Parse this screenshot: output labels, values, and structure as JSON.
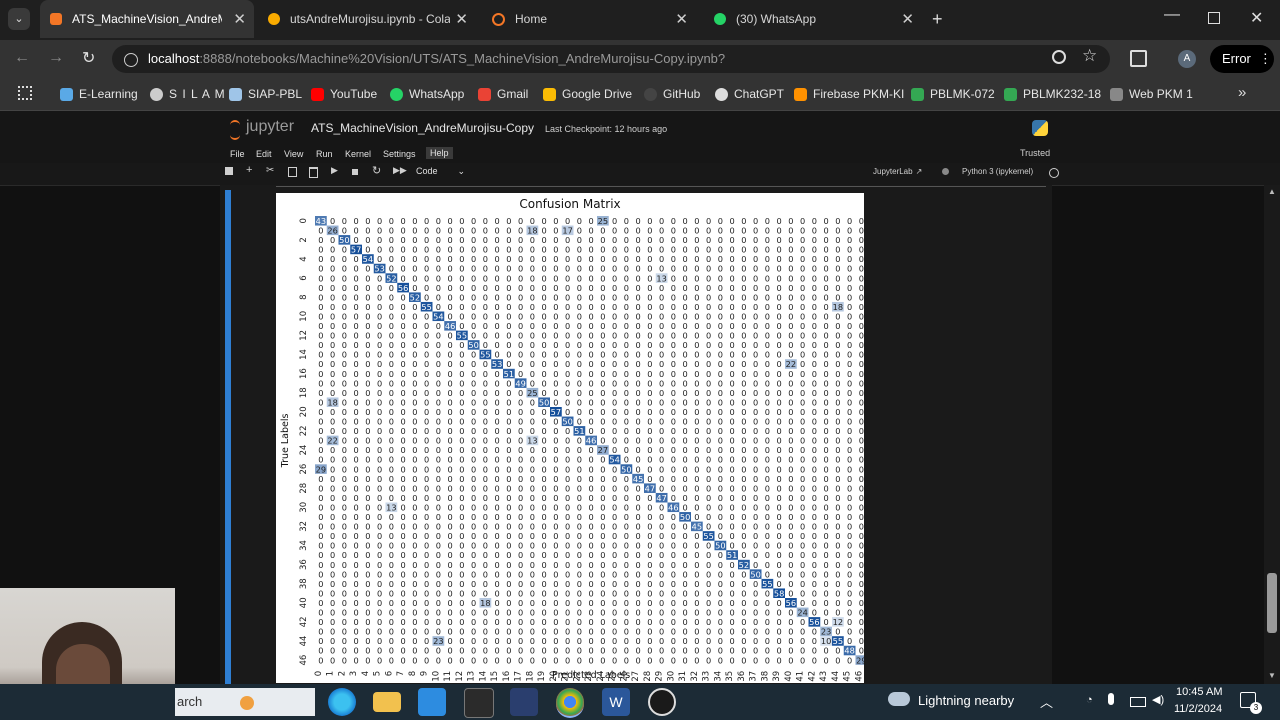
{
  "tabs": [
    {
      "label": "ATS_MachineVision_AndreMuro",
      "favicon": "jupyter-icon",
      "active": true
    },
    {
      "label": "utsAndreMurojisu.ipynb - Colal",
      "favicon": "colab-icon",
      "active": false
    },
    {
      "label": "Home",
      "favicon": "jupyter-home-icon",
      "active": false
    },
    {
      "label": "(30) WhatsApp",
      "favicon": "whatsapp-icon",
      "active": false
    }
  ],
  "address": {
    "host": "localhost",
    "path": ":8888/notebooks/Machine%20Vision/UTS/ATS_MachineVision_AndreMurojisu-Copy.ipynb?"
  },
  "profile": {
    "initial": "A",
    "error_label": "Error"
  },
  "bookmarks": [
    {
      "label": "E-Learning",
      "color": "#5aa9e6"
    },
    {
      "label": "S I L A M",
      "color": "#cccccc"
    },
    {
      "label": "SIAP-PBL",
      "color": "#9fc5e8"
    },
    {
      "label": "YouTube",
      "color": "#ff0000"
    },
    {
      "label": "WhatsApp",
      "color": "#25d366"
    },
    {
      "label": "Gmail",
      "color": "#ea4335"
    },
    {
      "label": "Google Drive",
      "color": "#fbbc04"
    },
    {
      "label": "GitHub",
      "color": "#444444"
    },
    {
      "label": "ChatGPT",
      "color": "#dddddd"
    },
    {
      "label": "Firebase PKM-KI",
      "color": "#ff9100"
    },
    {
      "label": "PBLMK-072",
      "color": "#34a853"
    },
    {
      "label": "PBLMK232-18",
      "color": "#34a853"
    },
    {
      "label": "Web PKM 1",
      "color": "#888888"
    }
  ],
  "jupyter": {
    "logo_text": "jupyter",
    "notebook_title": "ATS_MachineVision_AndreMurojisu-Copy",
    "checkpoint": "Last Checkpoint: 12 hours ago",
    "trusted": "Trusted",
    "menu": [
      "File",
      "Edit",
      "View",
      "Run",
      "Kernel",
      "Settings",
      "Help"
    ],
    "cell_type": "Code",
    "jupyterlab_link": "JupyterLab",
    "kernel": "Python 3 (ipykernel)"
  },
  "chart_data": {
    "type": "heatmap",
    "title": "Confusion Matrix",
    "xlabel": "Predicted Labels",
    "ylabel": "True Labels",
    "n_classes": 47,
    "diagonal": [
      43,
      26,
      50,
      57,
      54,
      53,
      52,
      56,
      52,
      55,
      54,
      46,
      55,
      50,
      55,
      53,
      51,
      49,
      25,
      50,
      57,
      50,
      51,
      46,
      27,
      54,
      50,
      45,
      47,
      47,
      46,
      50,
      45,
      55,
      50,
      51,
      52,
      50,
      55,
      58,
      56,
      24,
      56,
      23,
      55,
      48,
      29
    ],
    "notable_off_diagonal": [
      {
        "true": 0,
        "pred": 24,
        "value": 25
      },
      {
        "true": 1,
        "pred": 18,
        "value": 18
      },
      {
        "true": 1,
        "pred": 21,
        "value": 17
      },
      {
        "true": 6,
        "pred": 29,
        "value": 13
      },
      {
        "true": 9,
        "pred": 44,
        "value": 18
      },
      {
        "true": 15,
        "pred": 40,
        "value": 22
      },
      {
        "true": 19,
        "pred": 1,
        "value": 18
      },
      {
        "true": 23,
        "pred": 1,
        "value": 22
      },
      {
        "true": 18,
        "pred": 18,
        "value": 25
      },
      {
        "true": 23,
        "pred": 18,
        "value": 13
      },
      {
        "true": 26,
        "pred": 0,
        "value": 29
      },
      {
        "true": 30,
        "pred": 6,
        "value": 13
      },
      {
        "true": 40,
        "pred": 14,
        "value": 18
      },
      {
        "true": 44,
        "pred": 10,
        "value": 23
      },
      {
        "true": 42,
        "pred": 44,
        "value": 12
      },
      {
        "true": 44,
        "pred": 43,
        "value": 10
      }
    ]
  },
  "taskbar": {
    "search_text": "arch",
    "weather": "Lightning nearby",
    "time": "10:45 AM",
    "date": "11/2/2024",
    "notifications": "3"
  }
}
